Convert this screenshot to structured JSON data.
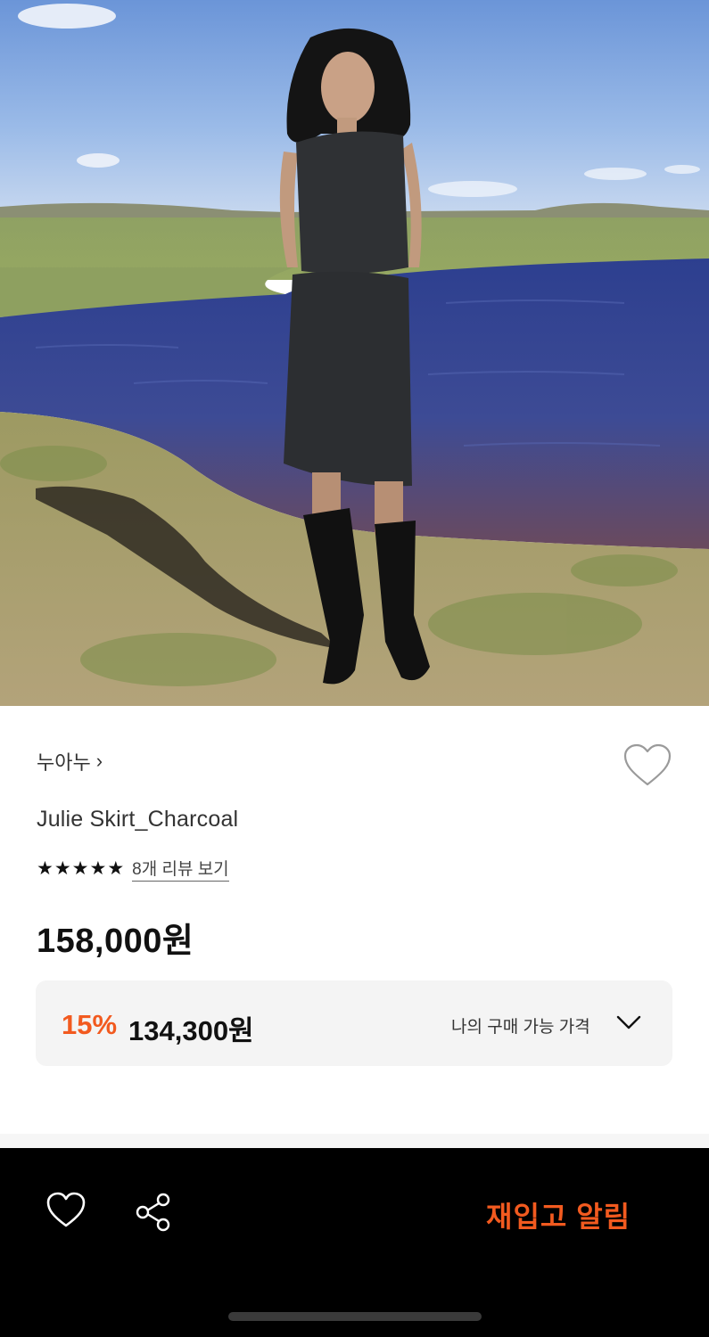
{
  "product": {
    "brand": "누아누",
    "brand_chevron": "›",
    "name": "Julie Skirt_Charcoal",
    "rating_stars": 5,
    "review_link": "8개 리뷰 보기",
    "price": "158,000원",
    "discount": {
      "rate": "15%",
      "price": "134,300원",
      "my_price_label": "나의 구매 가능 가격"
    }
  },
  "bottom_bar": {
    "restock_label": "재입고 알림"
  },
  "icons": {
    "wishlist": "heart-outline-icon",
    "my_price_toggle": "chevron-down-icon",
    "bottom_heart": "heart-outline-icon",
    "share": "share-icon"
  },
  "colors": {
    "accent": "#f25a1f",
    "bottom_bar_bg": "#000000",
    "discount_box_bg": "#f4f4f4"
  }
}
